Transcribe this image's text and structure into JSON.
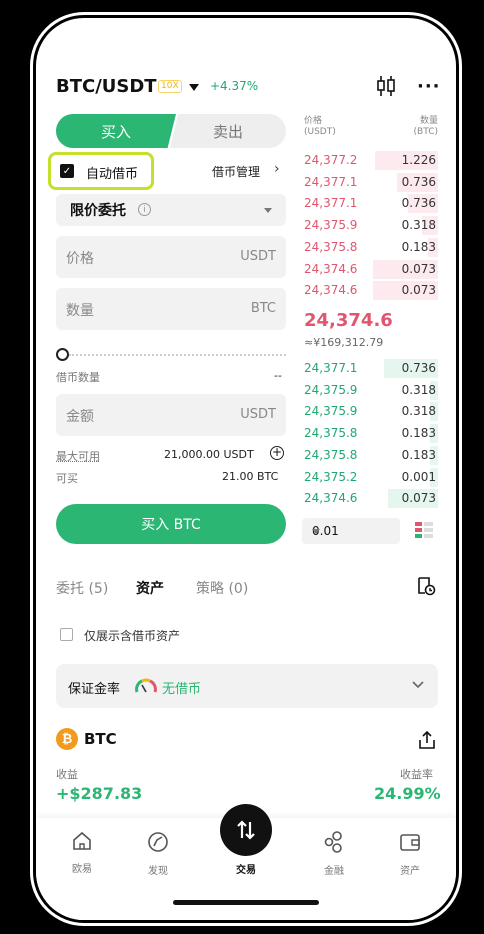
{
  "header": {
    "pair": "BTC/USDT",
    "leverage": "10X",
    "change": "+4.37%"
  },
  "trade_tabs": {
    "buy": "买入",
    "sell": "卖出"
  },
  "margin": {
    "auto_borrow_label": "自动借币",
    "auto_borrow_checked": true,
    "manage_label": "借币管理"
  },
  "order_form": {
    "order_type": "限价委托",
    "price_placeholder": "价格",
    "price_unit": "USDT",
    "amount_placeholder": "数量",
    "amount_unit": "BTC",
    "slider_value_pct": 0,
    "borrow_qty_label": "借币数量",
    "borrow_qty_value": "--",
    "total_placeholder": "金额",
    "total_unit": "USDT",
    "max_available_label": "最大可用",
    "max_available_value": "21,000.00 USDT",
    "can_buy_label": "可买",
    "can_buy_value": "21.00 BTC",
    "buy_button": "买入 BTC"
  },
  "orderbook": {
    "price_header": "价格",
    "price_unit": "(USDT)",
    "qty_header": "数量",
    "qty_unit": "(BTC)",
    "asks": [
      {
        "price": "24,377.2",
        "qty": "1.226",
        "depth": 0.46
      },
      {
        "price": "24,377.1",
        "qty": "0.736",
        "depth": 0.3
      },
      {
        "price": "24,377.1",
        "qty": "0.736",
        "depth": 0.22
      },
      {
        "price": "24,375.9",
        "qty": "0.318",
        "depth": 0.12
      },
      {
        "price": "24,375.8",
        "qty": "0.183",
        "depth": 0.07
      },
      {
        "price": "24,374.6",
        "qty": "0.073",
        "depth": 0.48
      },
      {
        "price": "24,374.6",
        "qty": "0.073",
        "depth": 0.48
      }
    ],
    "last_price": "24,374.6",
    "cny_price": "≈¥169,312.79",
    "bids": [
      {
        "price": "24,377.1",
        "qty": "0.736",
        "depth": 0.4
      },
      {
        "price": "24,375.9",
        "qty": "0.318",
        "depth": 0.06
      },
      {
        "price": "24,375.9",
        "qty": "0.318",
        "depth": 0.06
      },
      {
        "price": "24,375.8",
        "qty": "0.183",
        "depth": 0.06
      },
      {
        "price": "24,375.8",
        "qty": "0.183",
        "depth": 0.06
      },
      {
        "price": "24,375.2",
        "qty": "0.001",
        "depth": 0.06
      },
      {
        "price": "24,374.6",
        "qty": "0.073",
        "depth": 0.37
      }
    ],
    "precision": "0.01"
  },
  "bottom_tabs": {
    "orders": "委托 (5)",
    "assets": "资产",
    "strategy": "策略 (0)"
  },
  "assets": {
    "filter_label": "仅展示含借币资产",
    "margin_ratio_label": "保证金率",
    "margin_status": "无借币",
    "coin": "BTC",
    "coin_symbol": "₿",
    "pnl_label": "收益",
    "pnl_value": "+$287.83",
    "pnl_rate_label": "收益率",
    "pnl_rate_value": "24.99%"
  },
  "nav": {
    "home": "欧易",
    "discover": "发现",
    "trade": "交易",
    "finance": "金融",
    "assets": "资产"
  },
  "colors": {
    "green": "#2bb673",
    "red": "#e0566f",
    "highlight": "#c5e02b"
  }
}
